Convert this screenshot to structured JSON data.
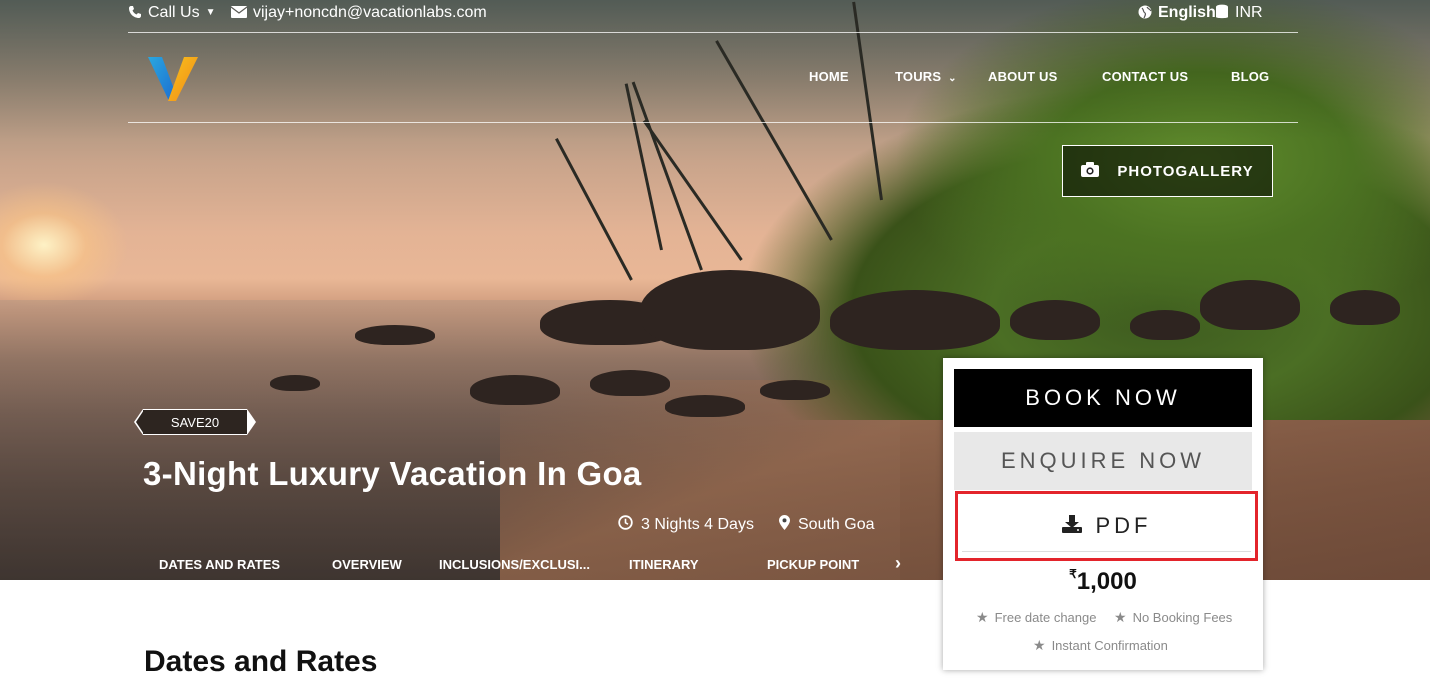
{
  "topbar": {
    "call_label": "Call Us",
    "email": "vijay+noncdn@vacationlabs.com",
    "language": "English",
    "currency": "INR"
  },
  "nav": {
    "items": [
      "HOME",
      "TOURS",
      "ABOUT US",
      "CONTACT US",
      "BLOG"
    ]
  },
  "hero": {
    "photogallery_label": "PHOTOGALLERY",
    "promo_code": "SAVE20",
    "title": "3-Night Luxury Vacation In Goa",
    "duration": "3 Nights 4 Days",
    "location": "South Goa"
  },
  "tabs": [
    "DATES AND RATES",
    "OVERVIEW",
    "INCLUSIONS/EXCLUSI...",
    "ITINERARY",
    "PICKUP POINT"
  ],
  "booking": {
    "book_label": "BOOK NOW",
    "enquire_label": "ENQUIRE NOW",
    "pdf_label": "PDF",
    "currency_symbol": "₹",
    "price": "1,000",
    "features": [
      "Free date change",
      "No Booking Fees",
      "Instant Confirmation"
    ]
  },
  "section": {
    "title": "Dates and Rates"
  },
  "colors": {
    "highlight_border": "#e3242b",
    "book_bg": "#000000",
    "enquire_bg": "#e8e8e8"
  }
}
